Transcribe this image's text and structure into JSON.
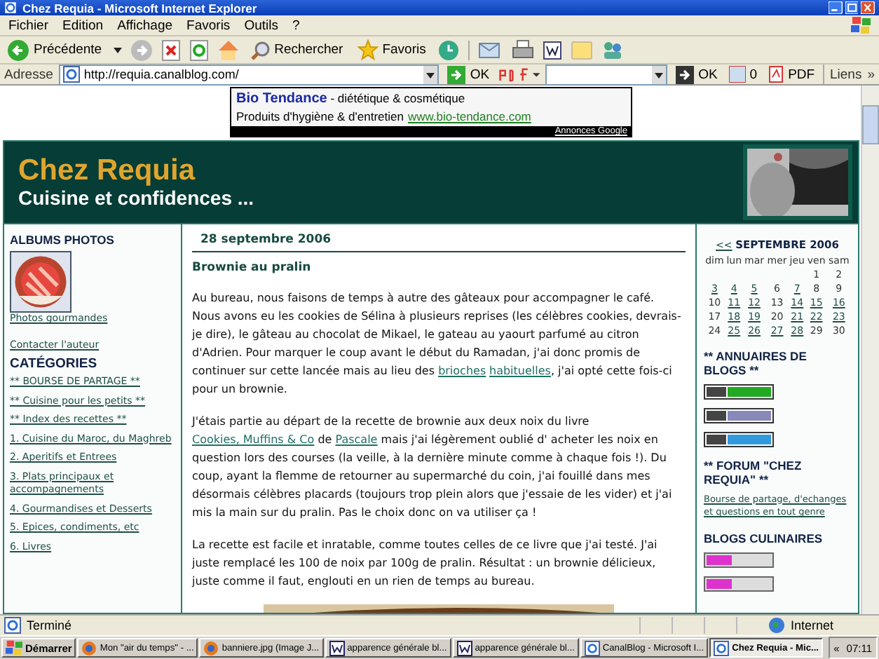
{
  "window": {
    "title": "Chez Requia - Microsoft Internet Explorer"
  },
  "menu": [
    "Fichier",
    "Edition",
    "Affichage",
    "Favoris",
    "Outils",
    "?"
  ],
  "toolbar": {
    "back": "Précédente",
    "search": "Rechercher",
    "favorites": "Favoris"
  },
  "address_bar": {
    "label": "Adresse",
    "value": "http://requia.canalblog.com/",
    "go": "OK",
    "ok2": "OK",
    "count": "0",
    "pdf": "PDF",
    "links": "Liens",
    "more": "»"
  },
  "ad": {
    "brand": "Bio Tendance",
    "tagline": " - diététique & cosmétique",
    "line2": "Produits d'hygiène & d'entretien",
    "url": "www.bio-tendance.com",
    "footer": "Annonces Google"
  },
  "header": {
    "title": "Chez Requia",
    "subtitle": "Cuisine et confidences ..."
  },
  "left_sidebar": {
    "albums_title": "ALBUMS PHOTOS",
    "album_link": "Photos gourmandes",
    "contact": "Contacter l'auteur",
    "categories_title": "CATÉGORIES",
    "categories": [
      "** BOURSE DE PARTAGE **",
      "** Cuisine pour les petits **",
      "** Index des recettes **",
      "1. Cuisine du Maroc, du Maghreb",
      "2. Aperitifs et Entrees",
      "3. Plats principaux et accompagnements",
      "4. Gourmandises et Desserts",
      "5. Epices, condiments, etc",
      "6. Livres"
    ]
  },
  "post": {
    "date": "28 septembre 2006",
    "title": "Brownie au pralin",
    "paragraphs": [
      [
        {
          "text": "Au bureau, nous faisons de temps à autre des gâteaux pour accompagner le café. Nous avons eu les cookies de Sélina à plusieurs reprises (les célèbres cookies, devrais-je dire), le gâteau au chocolat de Mikael, le gateau au yaourt parfumé au citron d'Adrien. Pour marquer le coup avant le début du Ramadan, j'ai donc promis de continuer sur cette lancée mais au lieu des ",
          "kind": "text"
        },
        {
          "text": "brioches",
          "kind": "link"
        },
        {
          "text": "habituelles",
          "kind": "link"
        },
        {
          "text": ", j'ai opté cette fois-ci pour un brownie.",
          "kind": "text"
        }
      ],
      [
        {
          "text": "J'étais partie au départ de la recette de brownie aux deux noix du livre ",
          "kind": "text"
        },
        {
          "text": "Cookies, Muffins & Co",
          "kind": "link"
        },
        {
          "text": " de ",
          "kind": "text"
        },
        {
          "text": "Pascale",
          "kind": "link"
        },
        {
          "text": " mais j'ai légèrement oublié d' acheter les noix en question lors des courses (la veille, à la dernière minute comme à chaque fois !). Du coup, ayant la flemme de retourner au supermarché du coin, j'ai fouillé dans mes désormais célèbres placards (toujours trop plein alors que j'essaie de les vider) et j'ai mis la main sur du pralin. Pas le choix donc on va utiliser ça !",
          "kind": "text"
        }
      ],
      [
        {
          "text": "La recette est facile et inratable, comme toutes celles de ce livre que j'ai testé. J'ai juste remplacé les 100 de noix par 100g de pralin. Résultat : un brownie délicieux, juste comme il faut, englouti en un rien de temps au bureau.",
          "kind": "text"
        }
      ]
    ]
  },
  "calendar": {
    "prev": "<<",
    "month": "SEPTEMBRE 2006",
    "weekdays": [
      "dim",
      "lun",
      "mar",
      "mer",
      "jeu",
      "ven",
      "sam"
    ],
    "weeks": [
      [
        {
          "day": "1",
          "link": false
        },
        {
          "day": "2",
          "link": false
        }
      ],
      [
        {
          "day": "3",
          "link": true
        },
        {
          "day": "4",
          "link": true
        },
        {
          "day": "5",
          "link": true
        },
        {
          "day": "6",
          "link": false
        },
        {
          "day": "7",
          "link": true
        },
        {
          "day": "8",
          "link": false
        },
        {
          "day": "9",
          "link": false
        }
      ],
      [
        {
          "day": "10",
          "link": false
        },
        {
          "day": "11",
          "link": true
        },
        {
          "day": "12",
          "link": true
        },
        {
          "day": "13",
          "link": false
        },
        {
          "day": "14",
          "link": true
        },
        {
          "day": "15",
          "link": true
        },
        {
          "day": "16",
          "link": true
        }
      ],
      [
        {
          "day": "17",
          "link": false
        },
        {
          "day": "18",
          "link": true
        },
        {
          "day": "19",
          "link": true
        },
        {
          "day": "20",
          "link": false
        },
        {
          "day": "21",
          "link": true
        },
        {
          "day": "22",
          "link": true
        },
        {
          "day": "23",
          "link": true
        }
      ],
      [
        {
          "day": "24",
          "link": false
        },
        {
          "day": "25",
          "link": true
        },
        {
          "day": "26",
          "link": true
        },
        {
          "day": "27",
          "link": true
        },
        {
          "day": "28",
          "link": true
        },
        {
          "day": "29",
          "link": false
        },
        {
          "day": "30",
          "link": false
        }
      ]
    ]
  },
  "right_sidebar": {
    "directories_title": "** ANNUAIRES DE BLOGS **",
    "directory_badges": [
      {
        "color": "#22aa22"
      },
      {
        "color": "#8888bb"
      },
      {
        "color": "#3399dd"
      }
    ],
    "forum_title": "** FORUM \"CHEZ REQUIA\" **",
    "forum_link": "Bourse de partage, d'echanges et questions en tout genre",
    "culinary_title": "BLOGS CULINAIRES",
    "culinary_badges": [
      {
        "color": "#dd33cc"
      },
      {
        "color": "#dd33cc"
      }
    ]
  },
  "status_bar": {
    "text": "Terminé",
    "zone": "Internet"
  },
  "taskbar": {
    "start": "Démarrer",
    "clock": "07:11",
    "chevron": "«",
    "items": [
      {
        "label": "Mon \"air du temps\" - ...",
        "kind": "browser",
        "selected": false
      },
      {
        "label": "banniere.jpg (Image J...",
        "kind": "browser",
        "selected": false
      },
      {
        "label": "apparence générale bl...",
        "kind": "word",
        "selected": false
      },
      {
        "label": "apparence générale bl...",
        "kind": "word",
        "selected": false
      },
      {
        "label": "CanalBlog - Microsoft I...",
        "kind": "ie",
        "selected": false
      },
      {
        "label": "Chez Requia - Mic...",
        "kind": "ie",
        "selected": true
      }
    ]
  }
}
